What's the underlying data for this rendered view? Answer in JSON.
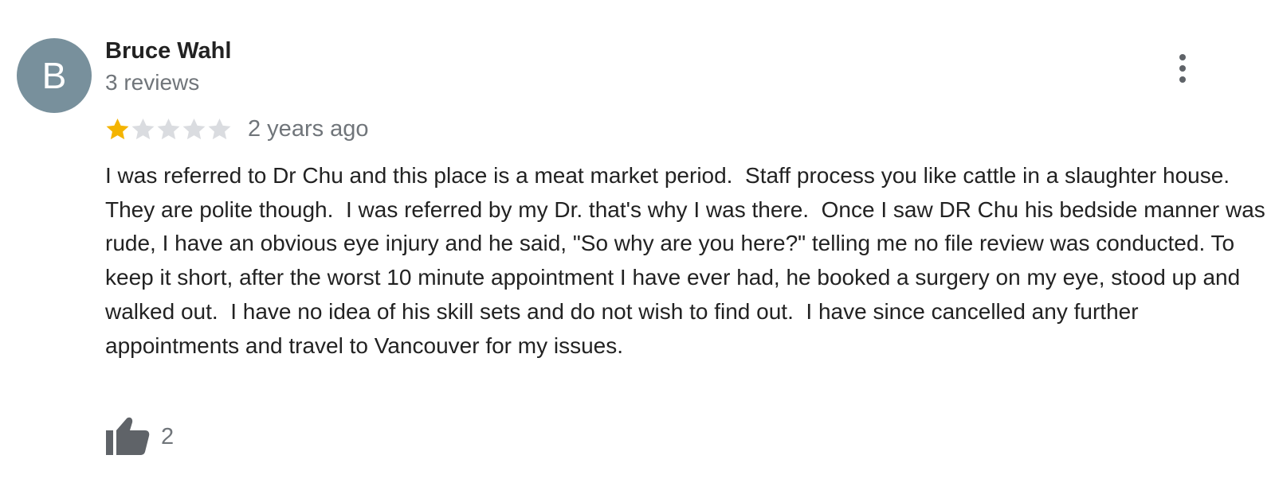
{
  "review": {
    "avatar_letter": "B",
    "reviewer_name": "Bruce Wahl",
    "review_count": "3 reviews",
    "rating": 1,
    "max_rating": 5,
    "time_ago": "2 years ago",
    "text": "I was referred to Dr Chu and this place is a meat market period.  Staff process you like cattle in a slaughter house.  They are polite though.  I was referred by my Dr. that's why I was there.  Once I saw DR Chu his bedside manner was rude, I have an obvious eye injury and he said, \"So why are you here?\" telling me no file review was conducted. To keep it short, after the worst 10 minute appointment I have ever had, he booked a surgery on my eye, stood up and walked out.  I have no idea of his skill sets and do not wish to find out.  I have since cancelled any further appointments and travel to Vancouver for my issues.",
    "like_count": "2"
  },
  "icons": {
    "menu": "more-vert-icon",
    "like": "thumbs-up-icon",
    "star": "star-icon"
  },
  "colors": {
    "avatar_bg": "#78909c",
    "star_filled": "#f4b400",
    "star_empty": "#dadce0",
    "secondary_text": "#70757a",
    "icon": "#5f6368"
  }
}
